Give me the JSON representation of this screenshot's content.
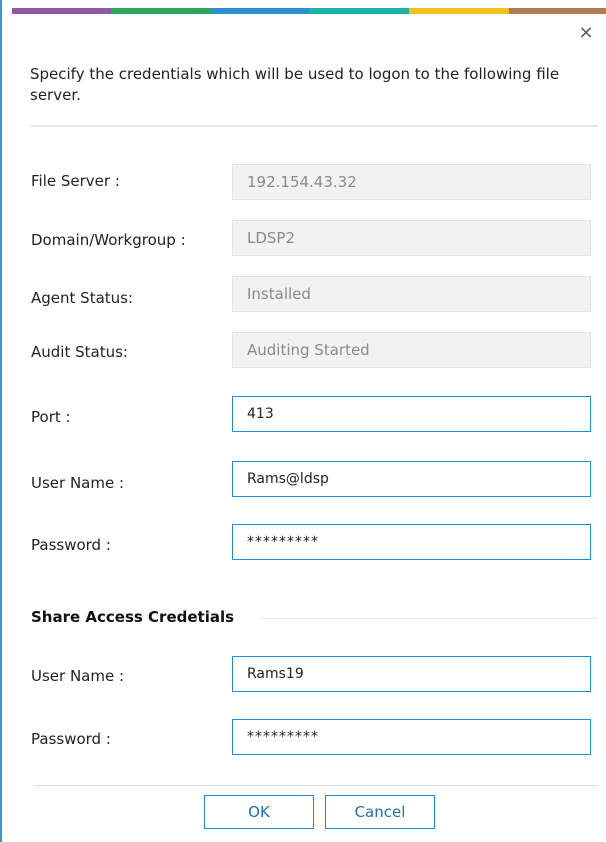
{
  "colors": {
    "strip": [
      "#8e5aa8",
      "#2aa65e",
      "#2b8fd0",
      "#1ab3a6",
      "#f1c21b",
      "#b07c4f"
    ],
    "accent": "#1f8ed6"
  },
  "dialog": {
    "close_icon": "×",
    "intro": "Specify the credentials which will be used to logon to the following file server."
  },
  "fields": {
    "file_server": {
      "label": "File Server :",
      "value": "192.154.43.32"
    },
    "domain": {
      "label": "Domain/Workgroup :",
      "value": "LDSP2"
    },
    "agent_status": {
      "label": "Agent Status:",
      "value": "Installed"
    },
    "audit_status": {
      "label": "Audit Status:",
      "value": "Auditing Started"
    },
    "port": {
      "label": "Port :",
      "value": "413"
    },
    "user_name": {
      "label": "User Name :",
      "value": "Rams@ldsp"
    },
    "password": {
      "label": "Password :",
      "value": "*********"
    }
  },
  "share_access": {
    "title": "Share Access Credetials",
    "user_name": {
      "label": "User Name :",
      "value": "Rams19"
    },
    "password": {
      "label": "Password :",
      "value": "*********"
    }
  },
  "buttons": {
    "ok": "OK",
    "cancel": "Cancel"
  }
}
